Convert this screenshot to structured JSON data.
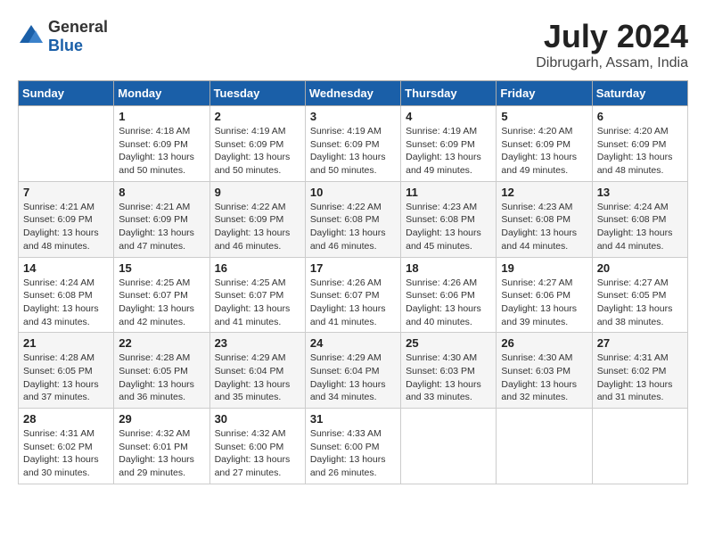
{
  "header": {
    "logo_general": "General",
    "logo_blue": "Blue",
    "month_year": "July 2024",
    "location": "Dibrugarh, Assam, India"
  },
  "weekdays": [
    "Sunday",
    "Monday",
    "Tuesday",
    "Wednesday",
    "Thursday",
    "Friday",
    "Saturday"
  ],
  "weeks": [
    [
      {
        "day": "",
        "info": ""
      },
      {
        "day": "1",
        "info": "Sunrise: 4:18 AM\nSunset: 6:09 PM\nDaylight: 13 hours\nand 50 minutes."
      },
      {
        "day": "2",
        "info": "Sunrise: 4:19 AM\nSunset: 6:09 PM\nDaylight: 13 hours\nand 50 minutes."
      },
      {
        "day": "3",
        "info": "Sunrise: 4:19 AM\nSunset: 6:09 PM\nDaylight: 13 hours\nand 50 minutes."
      },
      {
        "day": "4",
        "info": "Sunrise: 4:19 AM\nSunset: 6:09 PM\nDaylight: 13 hours\nand 49 minutes."
      },
      {
        "day": "5",
        "info": "Sunrise: 4:20 AM\nSunset: 6:09 PM\nDaylight: 13 hours\nand 49 minutes."
      },
      {
        "day": "6",
        "info": "Sunrise: 4:20 AM\nSunset: 6:09 PM\nDaylight: 13 hours\nand 48 minutes."
      }
    ],
    [
      {
        "day": "7",
        "info": ""
      },
      {
        "day": "8",
        "info": "Sunrise: 4:21 AM\nSunset: 6:09 PM\nDaylight: 13 hours\nand 47 minutes."
      },
      {
        "day": "9",
        "info": "Sunrise: 4:22 AM\nSunset: 6:09 PM\nDaylight: 13 hours\nand 46 minutes."
      },
      {
        "day": "10",
        "info": "Sunrise: 4:22 AM\nSunset: 6:08 PM\nDaylight: 13 hours\nand 46 minutes."
      },
      {
        "day": "11",
        "info": "Sunrise: 4:23 AM\nSunset: 6:08 PM\nDaylight: 13 hours\nand 45 minutes."
      },
      {
        "day": "12",
        "info": "Sunrise: 4:23 AM\nSunset: 6:08 PM\nDaylight: 13 hours\nand 44 minutes."
      },
      {
        "day": "13",
        "info": "Sunrise: 4:24 AM\nSunset: 6:08 PM\nDaylight: 13 hours\nand 44 minutes."
      }
    ],
    [
      {
        "day": "14",
        "info": ""
      },
      {
        "day": "15",
        "info": "Sunrise: 4:25 AM\nSunset: 6:07 PM\nDaylight: 13 hours\nand 42 minutes."
      },
      {
        "day": "16",
        "info": "Sunrise: 4:25 AM\nSunset: 6:07 PM\nDaylight: 13 hours\nand 41 minutes."
      },
      {
        "day": "17",
        "info": "Sunrise: 4:26 AM\nSunset: 6:07 PM\nDaylight: 13 hours\nand 41 minutes."
      },
      {
        "day": "18",
        "info": "Sunrise: 4:26 AM\nSunset: 6:06 PM\nDaylight: 13 hours\nand 40 minutes."
      },
      {
        "day": "19",
        "info": "Sunrise: 4:27 AM\nSunset: 6:06 PM\nDaylight: 13 hours\nand 39 minutes."
      },
      {
        "day": "20",
        "info": "Sunrise: 4:27 AM\nSunset: 6:05 PM\nDaylight: 13 hours\nand 38 minutes."
      }
    ],
    [
      {
        "day": "21",
        "info": ""
      },
      {
        "day": "22",
        "info": "Sunrise: 4:28 AM\nSunset: 6:05 PM\nDaylight: 13 hours\nand 36 minutes."
      },
      {
        "day": "23",
        "info": "Sunrise: 4:29 AM\nSunset: 6:04 PM\nDaylight: 13 hours\nand 35 minutes."
      },
      {
        "day": "24",
        "info": "Sunrise: 4:29 AM\nSunset: 6:04 PM\nDaylight: 13 hours\nand 34 minutes."
      },
      {
        "day": "25",
        "info": "Sunrise: 4:30 AM\nSunset: 6:03 PM\nDaylight: 13 hours\nand 33 minutes."
      },
      {
        "day": "26",
        "info": "Sunrise: 4:30 AM\nSunset: 6:03 PM\nDaylight: 13 hours\nand 32 minutes."
      },
      {
        "day": "27",
        "info": "Sunrise: 4:31 AM\nSunset: 6:02 PM\nDaylight: 13 hours\nand 31 minutes."
      }
    ],
    [
      {
        "day": "28",
        "info": "Sunrise: 4:31 AM\nSunset: 6:02 PM\nDaylight: 13 hours\nand 30 minutes."
      },
      {
        "day": "29",
        "info": "Sunrise: 4:32 AM\nSunset: 6:01 PM\nDaylight: 13 hours\nand 29 minutes."
      },
      {
        "day": "30",
        "info": "Sunrise: 4:32 AM\nSunset: 6:00 PM\nDaylight: 13 hours\nand 27 minutes."
      },
      {
        "day": "31",
        "info": "Sunrise: 4:33 AM\nSunset: 6:00 PM\nDaylight: 13 hours\nand 26 minutes."
      },
      {
        "day": "",
        "info": ""
      },
      {
        "day": "",
        "info": ""
      },
      {
        "day": "",
        "info": ""
      }
    ]
  ],
  "week1_sun_info": "Sunrise: 4:21 AM\nSunset: 6:09 PM\nDaylight: 13 hours\nand 48 minutes.",
  "week3_sun_info": "Sunrise: 4:24 AM\nSunset: 6:08 PM\nDaylight: 13 hours\nand 43 minutes.",
  "week4_sun_info": "Sunrise: 4:28 AM\nSunset: 6:05 PM\nDaylight: 13 hours\nand 37 minutes."
}
